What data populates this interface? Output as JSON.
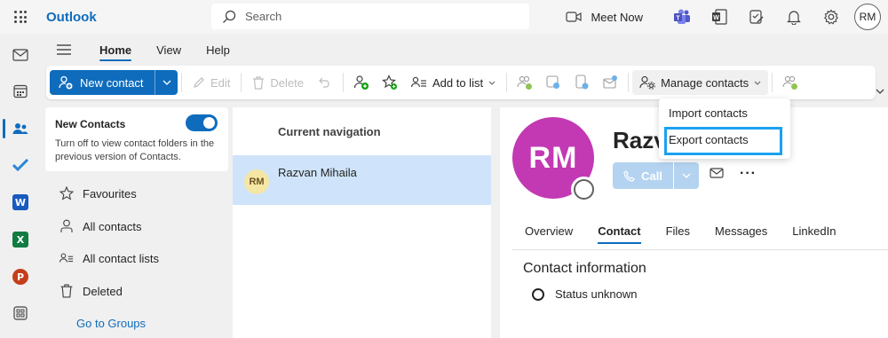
{
  "app": {
    "name": "Outlook"
  },
  "search": {
    "placeholder": "Search"
  },
  "topbar": {
    "meet_now": "Meet Now",
    "avatar_initials": "RM"
  },
  "ribbon": {
    "tabs": [
      "Home",
      "View",
      "Help"
    ],
    "active_tab": "Home",
    "new_contact": "New contact",
    "edit": "Edit",
    "delete": "Delete",
    "add_to_list": "Add to list",
    "manage_contacts": "Manage contacts"
  },
  "dropdown": {
    "items": [
      "Import contacts",
      "Export contacts"
    ],
    "highlighted": "Export contacts"
  },
  "nav": {
    "new_contacts_title": "New Contacts",
    "new_contacts_desc": "Turn off to view contact folders in the previous version of Contacts.",
    "toggle_on": true,
    "items": [
      "Favourites",
      "All contacts",
      "All contact lists",
      "Deleted"
    ],
    "groups_link": "Go to Groups"
  },
  "list": {
    "header": "Current navigation",
    "items": [
      {
        "initials": "RM",
        "name": "Razvan Mihaila"
      }
    ]
  },
  "detail": {
    "initials": "RM",
    "name_visible": "Razv",
    "call": "Call",
    "tabs": [
      "Overview",
      "Contact",
      "Files",
      "Messages",
      "LinkedIn"
    ],
    "active_tab": "Contact",
    "section_title": "Contact information",
    "status": "Status unknown"
  },
  "colors": {
    "accent": "#0f6cbd",
    "avatar_big": "#c239b3",
    "selection": "#cfe4fa",
    "highlight_box": "#1ba1f2"
  }
}
